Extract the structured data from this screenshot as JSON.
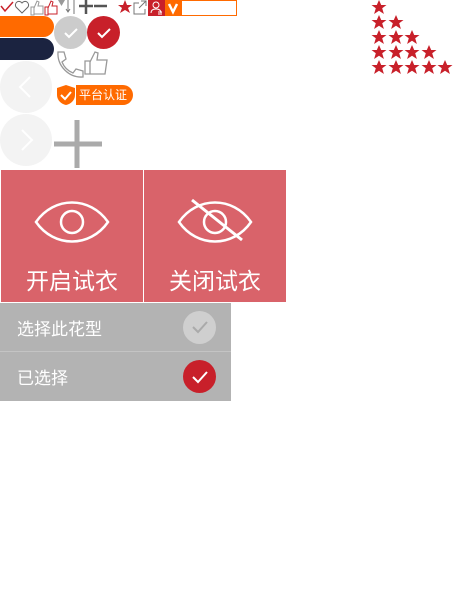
{
  "badge": {
    "label": "平台认证"
  },
  "tryon": {
    "open_label": "开启试衣",
    "close_label": "关闭试衣"
  },
  "pattern": {
    "select_label": "选择此花型",
    "selected_label": "已选择"
  },
  "ratings": [
    1,
    2,
    3,
    4,
    5
  ],
  "colors": {
    "accent": "#ff6a00",
    "red": "#c8202a",
    "navy": "#1b2340",
    "panel": "#d9636a",
    "list": "#b3b3b3"
  }
}
